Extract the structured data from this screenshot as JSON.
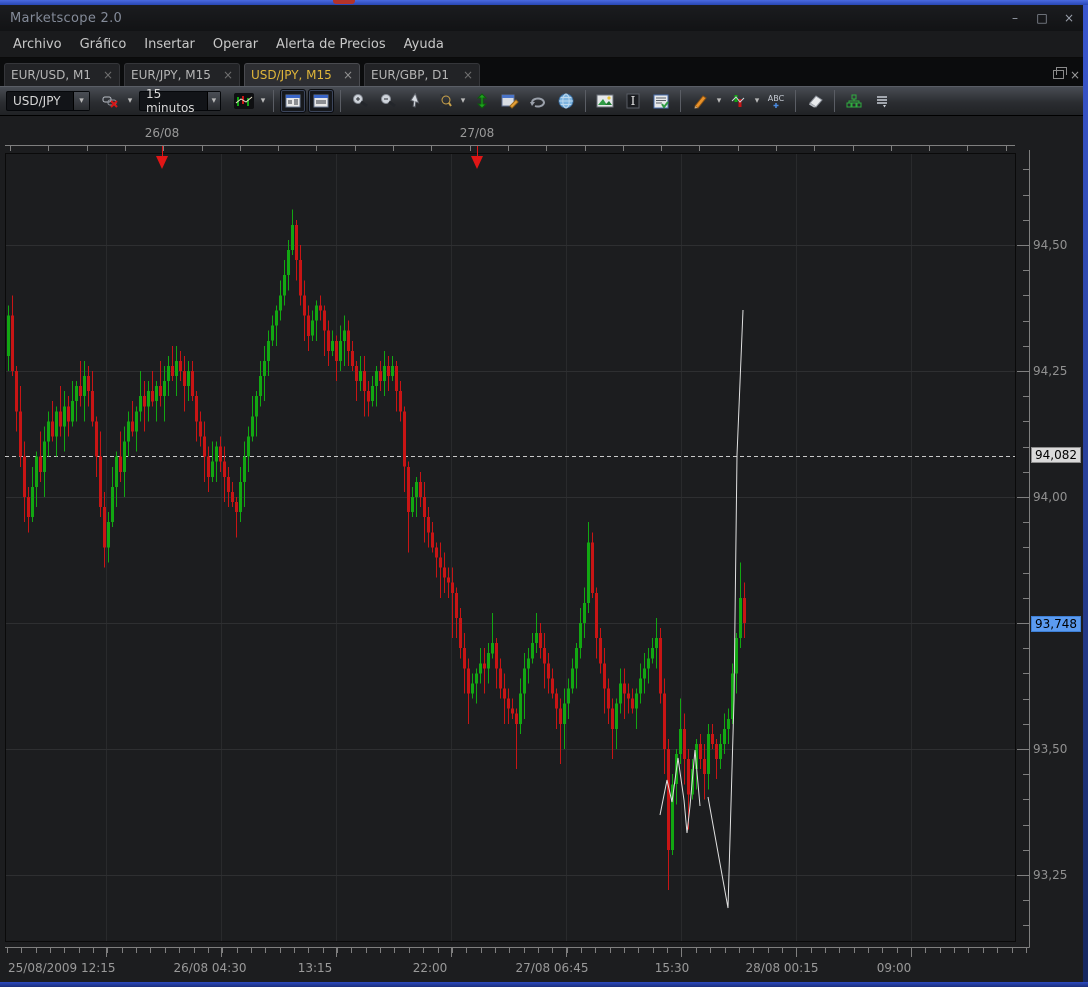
{
  "window": {
    "title": "Marketscope 2.0",
    "minimize_glyph": "–",
    "maximize_glyph": "□",
    "close_glyph": "×"
  },
  "menu": {
    "items": [
      "Archivo",
      "Gráfico",
      "Insertar",
      "Operar",
      "Alerta de Precios",
      "Ayuda"
    ]
  },
  "tabs": [
    {
      "label": "EUR/USD, M1",
      "close_glyph": "×",
      "active": false
    },
    {
      "label": "EUR/JPY, M15",
      "close_glyph": "×",
      "active": false
    },
    {
      "label": "USD/JPY, M15",
      "close_glyph": "×",
      "active": true
    },
    {
      "label": "EUR/GBP, D1",
      "close_glyph": "×",
      "active": false
    }
  ],
  "tabbar_close_glyph": "×",
  "toolbar": {
    "symbol_value": "USD/JPY",
    "period_value": "15 minutos",
    "dropdown_glyph": "▼",
    "icons": [
      "unlink-symbol",
      "chart-type",
      "quote-board",
      "agenda-board",
      "zoom-in",
      "zoom-out",
      "pointer",
      "zoom-interval",
      "fit-scale",
      "chart-properties",
      "refresh",
      "web-browser",
      "save-image",
      "text-cursor",
      "report",
      "draw-pencil",
      "price-marker",
      "text-label",
      "eraser",
      "object-manager",
      "list-menu"
    ],
    "text_label_glyph": "ABC",
    "text_cursor_glyph": "I"
  },
  "chart_data": {
    "type": "candlestick",
    "symbol": "USD/JPY",
    "period": "M15",
    "colors": {
      "up": "#12a712",
      "down": "#c81515",
      "grid": "#2e2f31",
      "vgrid": "#292a2c",
      "ruler": "#7f7f7f",
      "dashed_line": "#c9c9c9",
      "overlay": "#e0e0e0",
      "marker_arrow": "#e01616",
      "axis_text": "#9a9a9a",
      "avg_badge_bg": "#d9d9d9",
      "cur_badge_bg": "#5b9bf0",
      "bg": "#1c1d1f"
    },
    "y_axis": {
      "labels": [
        "94,50",
        "94,25",
        "94,00",
        "93,50",
        "93,25"
      ],
      "values": [
        94.5,
        94.25,
        94.0,
        93.5,
        93.25
      ],
      "major_step": 0.25,
      "minor_step": 0.05,
      "visible_top": 94.68,
      "visible_bottom": 93.12
    },
    "x_axis": {
      "labels": [
        "25/08/2009 12:15",
        "26/08 04:30",
        "13:15",
        "22:00",
        "27/08 06:45",
        "15:30",
        "28/08 00:15",
        "09:00"
      ]
    },
    "day_markers": {
      "labels": [
        "26/08",
        "27/08"
      ]
    },
    "avg_price": {
      "value": 94.082,
      "label": "94,082"
    },
    "current_price": {
      "value": 93.748,
      "label": "93,748"
    },
    "candles": [
      [
        94.28,
        94.38,
        94.25,
        94.36
      ],
      [
        94.36,
        94.4,
        94.24,
        94.25
      ],
      [
        94.25,
        94.26,
        94.13,
        94.17
      ],
      [
        94.17,
        94.22,
        94.06,
        94.08
      ],
      [
        94.08,
        94.11,
        93.95,
        94.0
      ],
      [
        94.0,
        94.02,
        93.93,
        93.96
      ],
      [
        93.96,
        94.06,
        93.95,
        94.02
      ],
      [
        94.02,
        94.09,
        93.98,
        94.08
      ],
      [
        94.08,
        94.13,
        94.03,
        94.05
      ],
      [
        94.05,
        94.14,
        94.0,
        94.11
      ],
      [
        94.11,
        94.17,
        94.08,
        94.15
      ],
      [
        94.15,
        94.19,
        94.11,
        94.12
      ],
      [
        94.12,
        94.18,
        94.08,
        94.17
      ],
      [
        94.17,
        94.22,
        94.12,
        94.14
      ],
      [
        94.14,
        94.21,
        94.09,
        94.18
      ],
      [
        94.18,
        94.2,
        94.12,
        94.15
      ],
      [
        94.15,
        94.23,
        94.14,
        94.19
      ],
      [
        94.19,
        94.23,
        94.15,
        94.22
      ],
      [
        94.22,
        94.27,
        94.18,
        94.2
      ],
      [
        94.2,
        94.27,
        94.15,
        94.24
      ],
      [
        94.24,
        94.26,
        94.18,
        94.21
      ],
      [
        94.21,
        94.25,
        94.14,
        94.15
      ],
      [
        94.15,
        94.16,
        94.04,
        94.08
      ],
      [
        94.08,
        94.13,
        93.96,
        93.98
      ],
      [
        93.98,
        94.01,
        93.86,
        93.9
      ],
      [
        93.9,
        93.97,
        93.87,
        93.95
      ],
      [
        93.95,
        94.06,
        93.94,
        94.02
      ],
      [
        94.02,
        94.09,
        93.98,
        94.08
      ],
      [
        94.08,
        94.13,
        94.03,
        94.05
      ],
      [
        94.05,
        94.14,
        94.0,
        94.11
      ],
      [
        94.11,
        94.17,
        94.08,
        94.15
      ],
      [
        94.15,
        94.19,
        94.12,
        94.13
      ],
      [
        94.13,
        94.18,
        94.09,
        94.17
      ],
      [
        94.17,
        94.25,
        94.15,
        94.2
      ],
      [
        94.2,
        94.23,
        94.13,
        94.18
      ],
      [
        94.18,
        94.23,
        94.15,
        94.21
      ],
      [
        94.21,
        94.25,
        94.18,
        94.19
      ],
      [
        94.19,
        94.23,
        94.15,
        94.22
      ],
      [
        94.22,
        94.27,
        94.18,
        94.2
      ],
      [
        94.2,
        94.26,
        94.15,
        94.23
      ],
      [
        94.23,
        94.28,
        94.2,
        94.26
      ],
      [
        94.26,
        94.3,
        94.23,
        94.24
      ],
      [
        94.24,
        94.3,
        94.2,
        94.27
      ],
      [
        94.27,
        94.29,
        94.23,
        94.25
      ],
      [
        94.25,
        94.28,
        94.17,
        94.22
      ],
      [
        94.22,
        94.27,
        94.19,
        94.25
      ],
      [
        94.25,
        94.27,
        94.19,
        94.2
      ],
      [
        94.2,
        94.21,
        94.11,
        94.15
      ],
      [
        94.15,
        94.17,
        94.1,
        94.12
      ],
      [
        94.12,
        94.15,
        94.03,
        94.08
      ],
      [
        94.08,
        94.1,
        94.01,
        94.04
      ],
      [
        94.04,
        94.11,
        94.03,
        94.07
      ],
      [
        94.07,
        94.11,
        94.03,
        94.1
      ],
      [
        94.1,
        94.12,
        94.05,
        94.07
      ],
      [
        94.07,
        94.1,
        93.99,
        94.04
      ],
      [
        94.04,
        94.06,
        93.98,
        94.01
      ],
      [
        94.01,
        94.03,
        93.98,
        93.99
      ],
      [
        93.99,
        94.0,
        93.92,
        93.97
      ],
      [
        93.97,
        94.06,
        93.95,
        94.03
      ],
      [
        94.03,
        94.11,
        93.98,
        94.08
      ],
      [
        94.08,
        94.14,
        94.05,
        94.12
      ],
      [
        94.12,
        94.2,
        94.11,
        94.16
      ],
      [
        94.16,
        94.21,
        94.12,
        94.2
      ],
      [
        94.2,
        94.27,
        94.18,
        94.24
      ],
      [
        94.24,
        94.3,
        94.19,
        94.27
      ],
      [
        94.27,
        94.33,
        94.24,
        94.31
      ],
      [
        94.31,
        94.36,
        94.3,
        94.34
      ],
      [
        94.34,
        94.38,
        94.3,
        94.37
      ],
      [
        94.37,
        94.43,
        94.35,
        94.4
      ],
      [
        94.4,
        94.47,
        94.38,
        94.44
      ],
      [
        94.44,
        94.51,
        94.41,
        94.49
      ],
      [
        94.49,
        94.57,
        94.48,
        94.54
      ],
      [
        94.54,
        94.55,
        94.43,
        94.47
      ],
      [
        94.47,
        94.5,
        94.38,
        94.4
      ],
      [
        94.4,
        94.43,
        94.31,
        94.36
      ],
      [
        94.36,
        94.38,
        94.29,
        94.32
      ],
      [
        94.32,
        94.37,
        94.31,
        94.35
      ],
      [
        94.35,
        94.39,
        94.31,
        94.38
      ],
      [
        94.38,
        94.4,
        94.35,
        94.37
      ],
      [
        94.37,
        94.38,
        94.28,
        94.33
      ],
      [
        94.33,
        94.35,
        94.26,
        94.29
      ],
      [
        94.29,
        94.33,
        94.28,
        94.31
      ],
      [
        94.31,
        94.32,
        94.23,
        94.27
      ],
      [
        94.27,
        94.34,
        94.25,
        94.31
      ],
      [
        94.31,
        94.36,
        94.26,
        94.33
      ],
      [
        94.33,
        94.35,
        94.26,
        94.29
      ],
      [
        94.29,
        94.31,
        94.25,
        94.26
      ],
      [
        94.26,
        94.27,
        94.19,
        94.23
      ],
      [
        94.23,
        94.28,
        94.21,
        94.25
      ],
      [
        94.25,
        94.28,
        94.16,
        94.21
      ],
      [
        94.21,
        94.23,
        94.16,
        94.19
      ],
      [
        94.19,
        94.24,
        94.18,
        94.22
      ],
      [
        94.22,
        94.26,
        94.18,
        94.25
      ],
      [
        94.25,
        94.27,
        94.21,
        94.23
      ],
      [
        94.23,
        94.29,
        94.2,
        94.26
      ],
      [
        94.26,
        94.28,
        94.21,
        94.24
      ],
      [
        94.24,
        94.28,
        94.23,
        94.26
      ],
      [
        94.26,
        94.27,
        94.17,
        94.21
      ],
      [
        94.21,
        94.23,
        94.15,
        94.17
      ],
      [
        94.17,
        94.18,
        94.01,
        94.06
      ],
      [
        94.06,
        94.07,
        93.89,
        93.97
      ],
      [
        93.97,
        94.02,
        93.96,
        94.0
      ],
      [
        94.0,
        94.04,
        93.96,
        94.03
      ],
      [
        94.03,
        94.05,
        93.98,
        94.0
      ],
      [
        94.0,
        94.03,
        93.91,
        93.96
      ],
      [
        93.96,
        93.98,
        93.9,
        93.93
      ],
      [
        93.93,
        93.95,
        93.89,
        93.9
      ],
      [
        93.9,
        93.91,
        93.84,
        93.88
      ],
      [
        93.88,
        93.91,
        93.8,
        93.86
      ],
      [
        93.86,
        93.89,
        93.81,
        93.84
      ],
      [
        93.84,
        93.86,
        93.8,
        93.83
      ],
      [
        93.83,
        93.86,
        93.72,
        93.81
      ],
      [
        93.81,
        93.82,
        93.72,
        93.76
      ],
      [
        93.76,
        93.78,
        93.68,
        93.7
      ],
      [
        93.7,
        93.73,
        93.61,
        93.66
      ],
      [
        93.66,
        93.68,
        93.55,
        93.61
      ],
      [
        93.61,
        93.65,
        93.6,
        93.63
      ],
      [
        93.63,
        93.66,
        93.59,
        93.65
      ],
      [
        93.65,
        93.7,
        93.63,
        93.67
      ],
      [
        93.67,
        93.7,
        93.61,
        93.66
      ],
      [
        93.66,
        93.71,
        93.63,
        93.69
      ],
      [
        93.69,
        93.77,
        93.68,
        93.71
      ],
      [
        93.71,
        93.72,
        93.62,
        93.66
      ],
      [
        93.66,
        93.68,
        93.6,
        93.62
      ],
      [
        93.62,
        93.65,
        93.55,
        93.6
      ],
      [
        93.6,
        93.62,
        93.55,
        93.58
      ],
      [
        93.58,
        93.6,
        93.56,
        93.57
      ],
      [
        93.57,
        93.58,
        93.46,
        93.55
      ],
      [
        93.55,
        93.64,
        93.53,
        93.61
      ],
      [
        93.61,
        93.69,
        93.56,
        93.66
      ],
      [
        93.66,
        93.7,
        93.63,
        93.68
      ],
      [
        93.68,
        93.73,
        93.67,
        93.71
      ],
      [
        93.71,
        93.77,
        93.69,
        93.73
      ],
      [
        93.73,
        93.75,
        93.68,
        93.7
      ],
      [
        93.7,
        93.73,
        93.62,
        93.67
      ],
      [
        93.67,
        93.69,
        93.61,
        93.64
      ],
      [
        93.64,
        93.66,
        93.6,
        93.61
      ],
      [
        93.61,
        93.62,
        93.54,
        93.58
      ],
      [
        93.58,
        93.6,
        93.47,
        93.55
      ],
      [
        93.55,
        93.62,
        93.5,
        93.59
      ],
      [
        93.59,
        93.64,
        93.56,
        93.62
      ],
      [
        93.62,
        93.68,
        93.61,
        93.66
      ],
      [
        93.66,
        93.71,
        93.62,
        93.7
      ],
      [
        93.7,
        93.78,
        93.68,
        93.75
      ],
      [
        93.75,
        93.82,
        93.72,
        93.79
      ],
      [
        93.79,
        93.95,
        93.77,
        93.91
      ],
      [
        93.91,
        93.93,
        93.8,
        93.81
      ],
      [
        93.81,
        93.82,
        93.68,
        93.72
      ],
      [
        93.72,
        93.74,
        93.65,
        93.67
      ],
      [
        93.67,
        93.7,
        93.57,
        93.62
      ],
      [
        93.62,
        93.64,
        93.55,
        93.58
      ],
      [
        93.58,
        93.6,
        93.48,
        93.54
      ],
      [
        93.54,
        93.6,
        93.5,
        93.59
      ],
      [
        93.59,
        93.66,
        93.57,
        93.63
      ],
      [
        93.63,
        93.66,
        93.56,
        93.61
      ],
      [
        93.61,
        93.63,
        93.57,
        93.6
      ],
      [
        93.6,
        93.62,
        93.57,
        93.58
      ],
      [
        93.58,
        93.62,
        93.54,
        93.61
      ],
      [
        93.61,
        93.67,
        93.59,
        93.64
      ],
      [
        93.64,
        93.69,
        93.61,
        93.66
      ],
      [
        93.66,
        93.7,
        93.63,
        93.68
      ],
      [
        93.68,
        93.72,
        93.67,
        93.7
      ],
      [
        93.7,
        93.76,
        93.66,
        93.72
      ],
      [
        93.72,
        93.74,
        93.59,
        93.61
      ],
      [
        93.61,
        93.64,
        93.45,
        93.5
      ],
      [
        93.5,
        93.52,
        93.22,
        93.3
      ],
      [
        93.3,
        93.45,
        93.29,
        93.43
      ],
      [
        93.43,
        93.5,
        93.39,
        93.49
      ],
      [
        93.49,
        93.6,
        93.47,
        93.54
      ],
      [
        93.54,
        93.57,
        93.43,
        93.48
      ],
      [
        93.48,
        93.5,
        93.34,
        93.41
      ],
      [
        93.41,
        93.48,
        93.4,
        93.46
      ],
      [
        93.46,
        93.52,
        93.42,
        93.51
      ],
      [
        93.51,
        93.53,
        93.46,
        93.48
      ],
      [
        93.48,
        93.51,
        93.4,
        93.45
      ],
      [
        93.45,
        93.55,
        93.42,
        93.53
      ],
      [
        93.53,
        93.55,
        93.5,
        93.51
      ],
      [
        93.51,
        93.52,
        93.44,
        93.48
      ],
      [
        93.48,
        93.53,
        93.46,
        93.51
      ],
      [
        93.51,
        93.57,
        93.49,
        93.54
      ],
      [
        93.54,
        93.58,
        93.51,
        93.56
      ],
      [
        93.56,
        93.67,
        93.55,
        93.65
      ],
      [
        93.65,
        93.73,
        93.61,
        93.72
      ],
      [
        93.72,
        93.87,
        93.7,
        93.8
      ],
      [
        93.8,
        93.83,
        93.72,
        93.75
      ]
    ],
    "overlay_lines": [
      [
        [
          660,
          815
        ],
        [
          667,
          780
        ],
        [
          672,
          802
        ],
        [
          678,
          758
        ],
        [
          684,
          800
        ],
        [
          687,
          833
        ],
        [
          690,
          806
        ],
        [
          695,
          750
        ],
        [
          700,
          806
        ]
      ],
      [
        [
          708,
          797
        ],
        [
          728,
          908
        ],
        [
          734,
          700
        ],
        [
          737,
          455
        ],
        [
          743,
          310
        ]
      ]
    ]
  }
}
